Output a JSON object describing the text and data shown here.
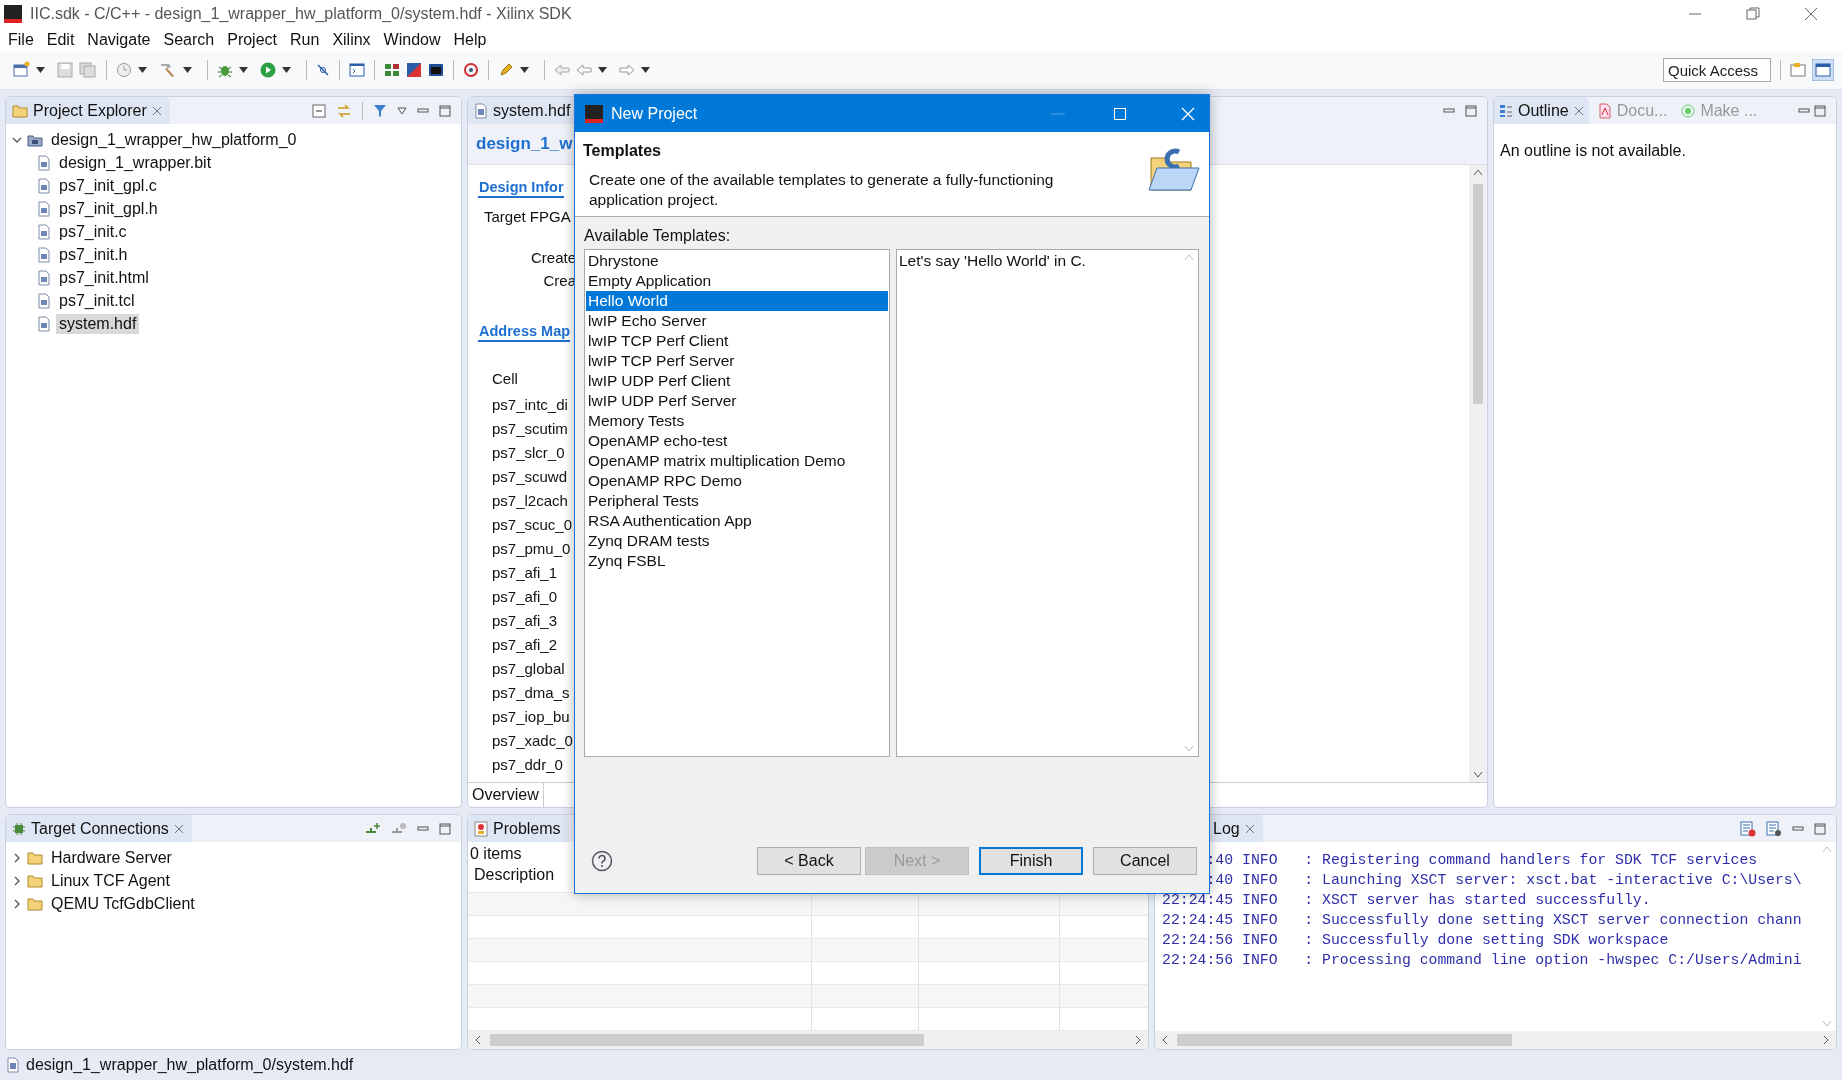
{
  "window": {
    "title": "IIC.sdk - C/C++ - design_1_wrapper_hw_platform_0/system.hdf - Xilinx SDK"
  },
  "menu": [
    "File",
    "Edit",
    "Navigate",
    "Search",
    "Project",
    "Run",
    "Xilinx",
    "Window",
    "Help"
  ],
  "quick_access": {
    "placeholder": "Quick Access"
  },
  "project_explorer": {
    "title": "Project Explorer",
    "tree": [
      {
        "label": "design_1_wrapper_hw_platform_0",
        "expanded": true,
        "selected": false,
        "children": [
          {
            "label": "design_1_wrapper.bit",
            "selected": false
          },
          {
            "label": "ps7_init_gpl.c",
            "selected": false
          },
          {
            "label": "ps7_init_gpl.h",
            "selected": false
          },
          {
            "label": "ps7_init.c",
            "selected": false
          },
          {
            "label": "ps7_init.h",
            "selected": false
          },
          {
            "label": "ps7_init.html",
            "selected": false
          },
          {
            "label": "ps7_init.tcl",
            "selected": false
          },
          {
            "label": "system.hdf",
            "selected": true
          }
        ]
      }
    ]
  },
  "editor": {
    "tab": "system.hdf",
    "heading": "design_1_w",
    "design_section": "Design Infor",
    "target_label": "Target FPGA",
    "created_labels": [
      "Create",
      "Crea"
    ],
    "address_section": "Address Map",
    "cell_header": "Cell",
    "cells": [
      "ps7_intc_di",
      "ps7_scutim",
      "ps7_slcr_0",
      "ps7_scuwd",
      "ps7_l2cach",
      "ps7_scuc_0",
      "ps7_pmu_0",
      "ps7_afi_1",
      "ps7_afi_0",
      "ps7_afi_3",
      "ps7_afi_2",
      "ps7_global",
      "ps7_dma_s",
      "ps7_iop_bu",
      "ps7_xadc_0",
      "ps7_ddr_0"
    ],
    "bottom_tab": "Overview"
  },
  "outline": {
    "tabs": [
      {
        "label": "Outline",
        "selected": true
      },
      {
        "label": "Docu...",
        "selected": false
      },
      {
        "label": "Make ...",
        "selected": false
      }
    ],
    "message": "An outline is not available."
  },
  "target_connections": {
    "title": "Target Connections",
    "items": [
      {
        "label": "Hardware Server",
        "expanded": false
      },
      {
        "label": "Linux TCF Agent",
        "expanded": false
      },
      {
        "label": "QEMU TcfGdbClient",
        "expanded": false
      }
    ]
  },
  "problems": {
    "title": "Problems",
    "count": "0 items",
    "columns": [
      "Description"
    ]
  },
  "log": {
    "title": "Log",
    "lines": [
      {
        "time": ":40",
        "level": "INFO",
        "message": ": Registering command handlers for SDK TCF services"
      },
      {
        "time": ":40",
        "level": "INFO",
        "message": ": Launching XSCT server: xsct.bat -interactive C:\\Users\\"
      },
      {
        "time": "22:24:45",
        "level": "INFO",
        "message": ": XSCT server has started successfully."
      },
      {
        "time": "22:24:45",
        "level": "INFO",
        "message": ": Successfully done setting XSCT server connection chann"
      },
      {
        "time": "22:24:56",
        "level": "INFO",
        "message": ": Successfully done setting SDK workspace"
      },
      {
        "time": "22:24:56",
        "level": "INFO",
        "message": ": Processing command line option -hwspec C:/Users/Admini"
      }
    ]
  },
  "status_bar": {
    "text": "design_1_wrapper_hw_platform_0/system.hdf"
  },
  "dialog": {
    "title": "New Project",
    "heading": "Templates",
    "description": "Create one of the available templates to generate a fully-functioning application project.",
    "list_label": "Available Templates:",
    "templates": [
      {
        "label": "Dhrystone",
        "selected": false
      },
      {
        "label": "Empty Application",
        "selected": false
      },
      {
        "label": "Hello World",
        "selected": true
      },
      {
        "label": "lwIP Echo Server",
        "selected": false
      },
      {
        "label": "lwIP TCP Perf Client",
        "selected": false
      },
      {
        "label": "lwIP TCP Perf Server",
        "selected": false
      },
      {
        "label": "lwIP UDP Perf Client",
        "selected": false
      },
      {
        "label": "lwIP UDP Perf Server",
        "selected": false
      },
      {
        "label": "Memory Tests",
        "selected": false
      },
      {
        "label": "OpenAMP echo-test",
        "selected": false
      },
      {
        "label": "OpenAMP matrix multiplication Demo",
        "selected": false
      },
      {
        "label": "OpenAMP RPC Demo",
        "selected": false
      },
      {
        "label": "Peripheral Tests",
        "selected": false
      },
      {
        "label": "RSA Authentication App",
        "selected": false
      },
      {
        "label": "Zynq DRAM tests",
        "selected": false
      },
      {
        "label": "Zynq FSBL",
        "selected": false
      }
    ],
    "template_description": "Let's say 'Hello World' in C.",
    "buttons": [
      {
        "label": "< Back",
        "disabled": false,
        "default": false
      },
      {
        "label": "Next >",
        "disabled": true,
        "default": false
      },
      {
        "label": "Finish",
        "disabled": false,
        "default": true
      },
      {
        "label": "Cancel",
        "disabled": false,
        "default": false
      }
    ]
  }
}
